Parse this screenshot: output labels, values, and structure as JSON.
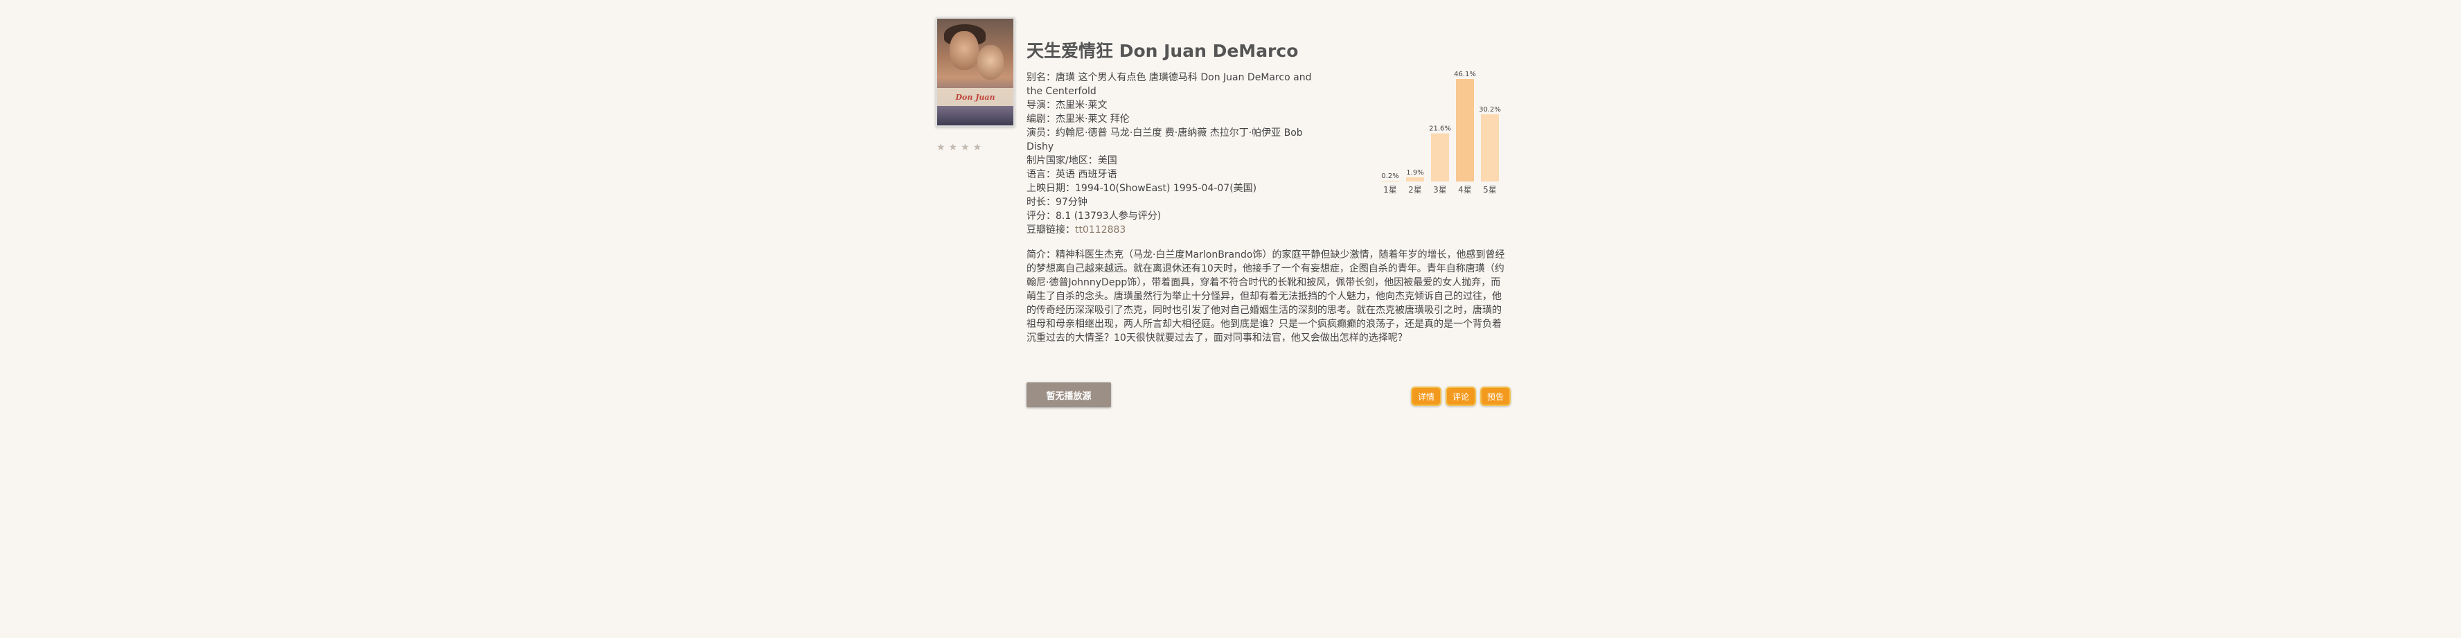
{
  "movie": {
    "title": "天生爱情狂 Don Juan DeMarco",
    "poster_text": "Don Juan",
    "stars": "★★★★",
    "aliases_label": "别名：",
    "aliases": "唐璜  这个男人有点色  唐璜德马科  Don Juan DeMarco and the Centerfold",
    "director_label": "导演：",
    "director": "杰里米·莱文",
    "writer_label": "编剧：",
    "writer": "杰里米·莱文  拜伦",
    "cast_label": "演员：",
    "cast": "约翰尼·德普  马龙·白兰度  费·唐纳薇  杰拉尔丁·帕伊亚  Bob Dishy",
    "country_label": "制片国家/地区：",
    "country": "美国",
    "language_label": "语言：",
    "language": "英语  西班牙语",
    "release_label": "上映日期：",
    "release": "1994-10(ShowEast)  1995-04-07(美国)",
    "runtime_label": "时长：",
    "runtime": "97分钟",
    "rating_label": "评分：",
    "rating": "8.1 (13793人参与评分)",
    "imdb_label": "豆瓣链接：",
    "imdb": "tt0112883",
    "summary_label": "简介：",
    "summary": "精神科医生杰克（马龙·白兰度MarlonBrando饰）的家庭平静但缺少激情，随着年岁的增长，他感到曾经的梦想离自己越来越远。就在离退休还有10天时，他接手了一个有妄想症，企图自杀的青年。青年自称唐璜（约翰尼·德普JohnnyDepp饰），带着面具，穿着不符合时代的长靴和披风，佩带长剑，他因被最爱的女人抛弃，而萌生了自杀的念头。唐璜虽然行为举止十分怪异，但却有着无法抵挡的个人魅力，他向杰克倾诉自己的过往，他的传奇经历深深吸引了杰克，同时也引发了他对自己婚姻生活的深刻的思考。就在杰克被唐璜吸引之时，唐璜的祖母和母亲相继出现，两人所言却大相径庭。他到底是谁？只是一个疯疯癫癫的浪荡子，还是真的是一个背负着沉重过去的大情圣？10天很快就要过去了，面对同事和法官，他又会做出怎样的选择呢？"
  },
  "buttons": {
    "download": "暂无播放源",
    "detail": "详情",
    "comment": "评论",
    "trailer": "预告"
  },
  "colors": {
    "bar": "#fcd9b0",
    "bar_peak": "#f9c790",
    "action": "#f39a1e",
    "download": "#9c8f86"
  },
  "chart_data": {
    "type": "bar",
    "categories": [
      "1星",
      "2星",
      "3星",
      "4星",
      "5星"
    ],
    "values": [
      0.2,
      1.9,
      21.6,
      46.1,
      30.2
    ],
    "labels": [
      "0.2%",
      "1.9%",
      "21.6%",
      "46.1%",
      "30.2%"
    ],
    "ylim": [
      0,
      46.1
    ],
    "grid": false
  }
}
